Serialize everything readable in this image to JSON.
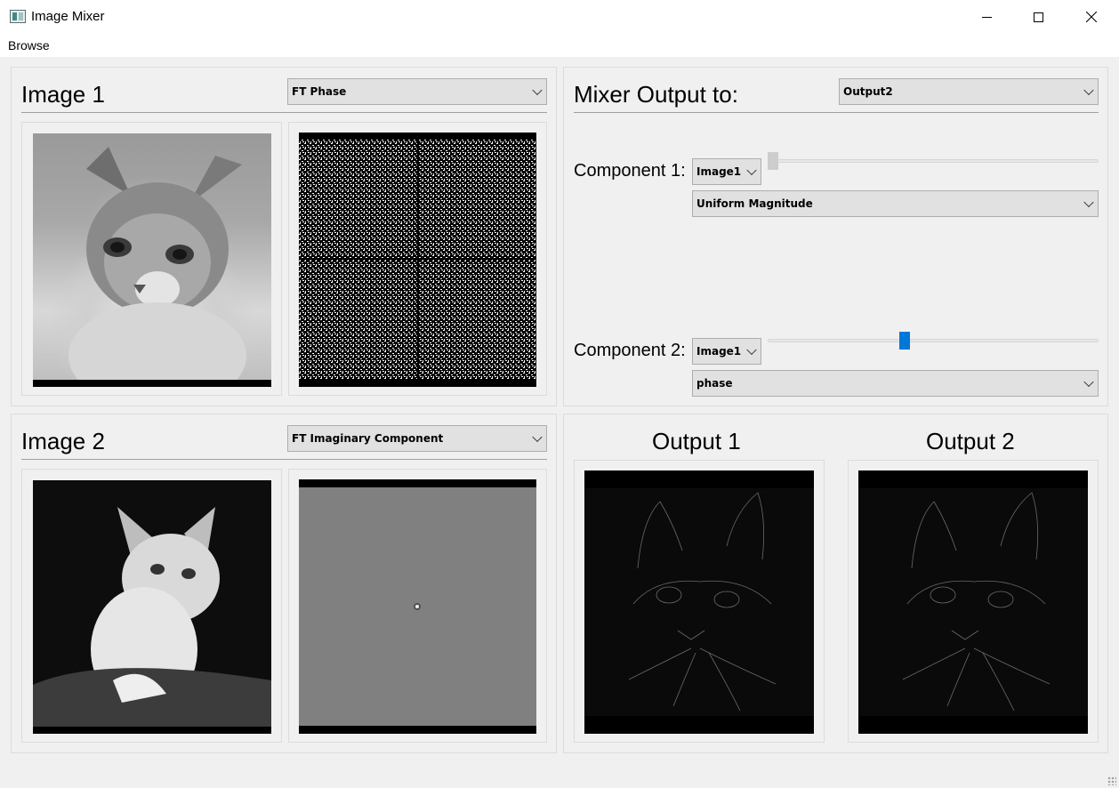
{
  "window": {
    "title": "Image Mixer"
  },
  "menu": {
    "items": [
      "Browse"
    ]
  },
  "image1": {
    "heading": "Image 1",
    "view_select": "FT Phase"
  },
  "image2": {
    "heading": "Image 2",
    "view_select": "FT Imaginary Component"
  },
  "mixer": {
    "heading": "Mixer Output to:",
    "output_select": "Output2",
    "component1": {
      "label": "Component 1:",
      "source": "Image1",
      "type": "Uniform Magnitude",
      "slider_fraction": 0.0
    },
    "component2": {
      "label": "Component 2:",
      "source": "Image1",
      "type": "phase",
      "slider_fraction": 0.42
    }
  },
  "outputs": {
    "output1_title": "Output 1",
    "output2_title": "Output 2"
  },
  "icons": {
    "app": "image-mixer-app-icon",
    "minimize": "minimize-icon",
    "maximize": "maximize-icon",
    "close": "close-icon"
  }
}
